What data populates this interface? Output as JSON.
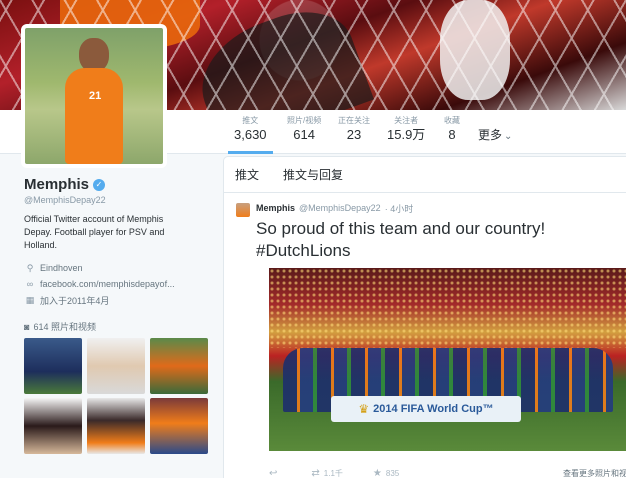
{
  "profile": {
    "name": "Memphis",
    "handle": "@MemphisDepay22",
    "bio": "Official Twitter account of Memphis Depay. Football player for PSV and Holland.",
    "location": "Eindhoven",
    "website": "facebook.com/memphisdepayof...",
    "joined": "加入于2011年4月",
    "avatar_number": "21"
  },
  "stats": [
    {
      "label": "推文",
      "value": "3,630"
    },
    {
      "label": "照片/视频",
      "value": "614"
    },
    {
      "label": "正在关注",
      "value": "23"
    },
    {
      "label": "关注者",
      "value": "15.9万"
    },
    {
      "label": "收藏",
      "value": "8"
    }
  ],
  "more_label": "更多",
  "photos": {
    "label": "614 照片和视频"
  },
  "tabs": [
    "推文",
    "推文与回复"
  ],
  "tweet": {
    "name": "Memphis",
    "handle": "@MemphisDepay22",
    "time": "· 4小时",
    "text_line1": "So proud of this team and our country!",
    "text_line2": "#DutchLions",
    "media_banner": "2014 FIFA World Cup™",
    "retweets": "1.1千",
    "favorites": "835",
    "view_more": "查看更多照片和视频"
  },
  "colors": {
    "accent": "#55acee",
    "orange": "#f07d1a"
  },
  "icons": {
    "verified": "verified-badge-icon",
    "location": "location-pin-icon",
    "link": "link-icon",
    "calendar": "calendar-icon",
    "camera": "camera-icon",
    "reply": "reply-icon",
    "retweet": "retweet-icon",
    "favorite": "star-icon",
    "more": "chevron-down-icon"
  }
}
